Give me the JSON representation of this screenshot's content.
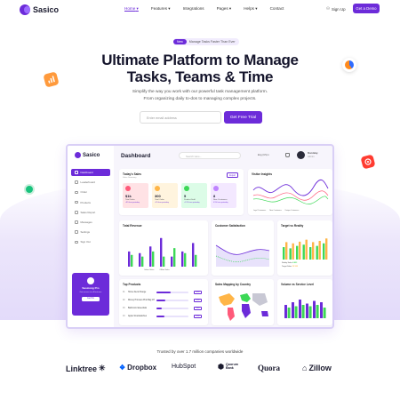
{
  "nav": {
    "brand": "Sasico",
    "links": [
      "Home",
      "Features",
      "Integrations",
      "Pages",
      "Helps",
      "Contact"
    ],
    "signup": "Sign Up",
    "demo": "Get a Demo"
  },
  "hero": {
    "badge_new": "New",
    "badge_text": "Manage Tasks Faster Than Ever",
    "title_line1": "Ultimate Platform to Manage",
    "title_line2": "Tasks, Teams & Time",
    "sub_line1": "Simplify the way you work with our powerful task management platform.",
    "sub_line2": "From organizing daily to-dos to managing complex projects.",
    "email_placeholder": "Enter email address",
    "cta": "Get Free Trial"
  },
  "dashboard": {
    "brand": "Sasico",
    "title": "Dashboard",
    "search": "Search Here...",
    "language": "Eng (US)",
    "user_name": "Mandalay",
    "user_role": "Admin",
    "menu": [
      "Dashboard",
      "Leaderboard",
      "Order",
      "Products",
      "Sales Report",
      "Messages",
      "Settings",
      "Sign Out"
    ],
    "promo": {
      "title": "Sasicong Pro",
      "sub": "Get access to all features",
      "button": "Get Pro"
    },
    "sales": {
      "title": "Today's Sales",
      "sub": "Sales Summary",
      "export": "Export",
      "tiles": [
        {
          "value": "$1k",
          "label": "Total Sales",
          "change": "+8% from yesterday",
          "color": "#ff5a7a"
        },
        {
          "value": "300",
          "label": "Total Order",
          "change": "+5% from yesterday",
          "color": "#ffb547"
        },
        {
          "value": "5",
          "label": "Product Sold",
          "change": "+1.2% from yesterday",
          "color": "#3cd856"
        },
        {
          "value": "8",
          "label": "New Customers",
          "change": "0.5% from yesterday",
          "color": "#bf83ff"
        }
      ]
    },
    "visitor": {
      "title": "Visitor Insights",
      "legend": [
        "Loyal Customers",
        "New Customers",
        "Unique Customers"
      ]
    },
    "revenue": {
      "title": "Total Revenue",
      "legend": [
        "Online Sales",
        "Offline Sales"
      ]
    },
    "satisfaction": {
      "title": "Customer Satisfaction"
    },
    "target": {
      "title": "Target vs Reality",
      "items": [
        "Reality Sales",
        "Target Sales"
      ],
      "values": [
        "8.823",
        "12.122"
      ]
    },
    "top_products": {
      "title": "Top Products",
      "rows": [
        {
          "n": "01",
          "name": "Home Decor Range",
          "pct": 45,
          "label": "45%"
        },
        {
          "n": "02",
          "name": "Disney Princess Pink Bag 18'",
          "pct": 29,
          "label": "29%"
        },
        {
          "n": "03",
          "name": "Bathroom Essentials",
          "pct": 18,
          "label": "18%"
        },
        {
          "n": "04",
          "name": "Apple Smartwatches",
          "pct": 25,
          "label": "25%"
        }
      ]
    },
    "map": {
      "title": "Sales Mapping by Country"
    },
    "volume": {
      "title": "Volume vs Service Level"
    }
  },
  "trust": {
    "text": "Trusted by over 1.7 million companies worldwide",
    "brands": [
      "Linktree",
      "Dropbox",
      "HubSpot",
      "Quorum Bank",
      "Quora",
      "Zillow"
    ]
  },
  "colors": {
    "accent": "#6c2bd9",
    "accent_light": "#f1ecfd"
  }
}
